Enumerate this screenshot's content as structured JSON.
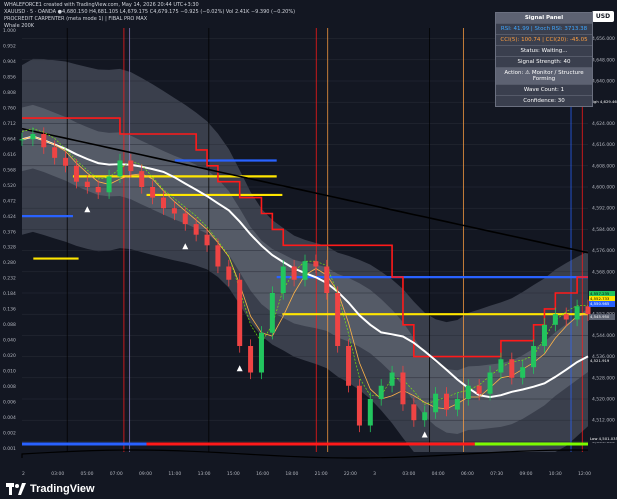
{
  "header": {
    "credit": "WHALEFORCE1 created with TradingView.com, May 14, 2026 20:44 UTC+3:30",
    "symbol_line": "XAUUSD · 5 · OANDA  ●4,680.150  H4,681.105  L4,679.175  C4,679.175  −0.925 (−0.02%)  Vol 2.41K  −9.390 (−0.20%)",
    "indicator_1": "PROCREDIT CARPENTER (meta mode 1)  | FIBAL PRO MAX",
    "indicator_2": "Whale 200K"
  },
  "currency_button": "USD",
  "brand": {
    "name": "TradingView",
    "logo": "tradingview-logo-icon"
  },
  "signal_panel": {
    "title": "Signal Panel",
    "rsi": "RSI: 41.99 | Stoch RSI: 3713.38",
    "cci": "CCI(5): 100.74 | CCI(20): -45.05",
    "status": "Status: Waiting...",
    "signal_strength": "Signal Strength: 40",
    "action": "Action: ⚠ Monitor / Structure Forming",
    "wave_count": "Wave Count: 1",
    "confidence": "Confidence: 30"
  },
  "colors": {
    "background": "#131722",
    "band_fill": "#5b6170",
    "candle_up": "#22c55e",
    "candle_down": "#ef4444",
    "yellow_level": "#ffe600",
    "blue_level": "#2962ff",
    "red_step": "#ff1a1a",
    "white_ma": "#ffffff",
    "black_ma": "#000000"
  },
  "chart_data": {
    "type": "line",
    "symbol": "XAUUSD",
    "timeframe": "5",
    "right_axis_ticks": [
      4656,
      4648,
      4640,
      4632,
      4624,
      4616,
      4608,
      4600,
      4592,
      4584,
      4576,
      4568,
      4560,
      4552,
      4544,
      4536,
      4528,
      4520,
      4512,
      4504
    ],
    "left_axis_ticks": [
      "1.000",
      "0.952",
      "0.904",
      "0.856",
      "0.808",
      "0.760",
      "0.712",
      "0.664",
      "0.616",
      "0.568",
      "0.520",
      "0.472",
      "0.424",
      "0.376",
      "0.328",
      "0.280",
      "0.232",
      "0.184",
      "0.136",
      "0.088",
      "0.040",
      "0.020",
      "0.010",
      "0.008",
      "0.006",
      "0.004",
      "0.002",
      "0.001"
    ],
    "x_tick_labels": [
      "2",
      "03:00",
      "05:00",
      "07:00",
      "09:00",
      "11:00",
      "13:00",
      "15:00",
      "16:00",
      "18:00",
      "21:00",
      "22:00",
      "3",
      "03:00",
      "04:00",
      "06:00",
      "07:30",
      "09:00",
      "10:30",
      "12:00"
    ],
    "price_labels": [
      {
        "label": "High",
        "value": "4,629.465"
      },
      {
        "label": "",
        "value": "4,557.235"
      },
      {
        "label": "",
        "value": "4,552.733"
      },
      {
        "label": "",
        "value": "4,550.985"
      },
      {
        "label": "",
        "value": "4,545.950"
      },
      {
        "label": "",
        "value": "4,521.919"
      },
      {
        "label": "Low",
        "value": "4,501.035"
      }
    ],
    "ylim": [
      4500,
      4660
    ],
    "close_series": [
      4618,
      4620,
      4615,
      4611,
      4608,
      4602,
      4600,
      4598,
      4604,
      4610,
      4606,
      4600,
      4596,
      4592,
      4590,
      4586,
      4582,
      4578,
      4570,
      4565,
      4540,
      4530,
      4545,
      4560,
      4570,
      4565,
      4572,
      4570,
      4560,
      4540,
      4525,
      4510,
      4520,
      4525,
      4530,
      4518,
      4512,
      4515,
      4522,
      4516,
      4520,
      4525,
      4522,
      4530,
      4535,
      4528,
      4532,
      4540,
      4548,
      4552,
      4550,
      4555,
      4552
    ],
    "levels": [
      {
        "color": "yellow",
        "value": 4604
      },
      {
        "color": "yellow",
        "value": 4597
      },
      {
        "color": "yellow",
        "value": 4573
      },
      {
        "color": "yellow",
        "value": 4552
      },
      {
        "color": "blue",
        "value": 4610
      },
      {
        "color": "blue",
        "value": 4589
      },
      {
        "color": "blue",
        "value": 4566
      }
    ]
  }
}
